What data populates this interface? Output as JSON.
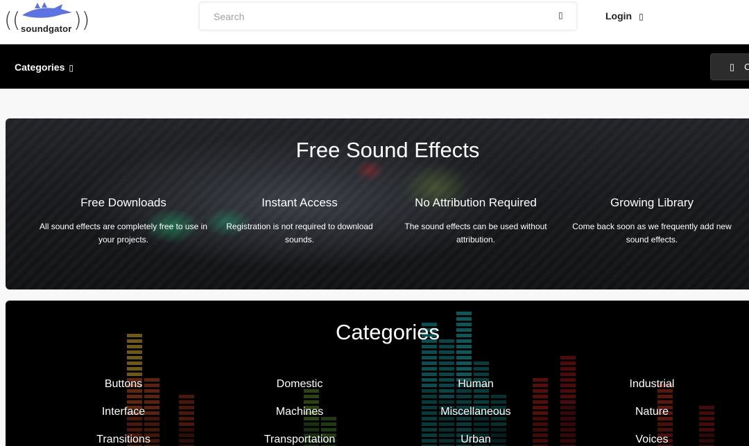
{
  "header": {
    "logo_text": "soundgator",
    "search_placeholder": "Search",
    "login_label": "Login"
  },
  "nav": {
    "categories_label": "Categories",
    "right_button_label": "C"
  },
  "hero": {
    "title": "Free Sound Effects",
    "features": [
      {
        "title": "Free Downloads",
        "desc": "All sound effects are completely free to use in your projects."
      },
      {
        "title": "Instant Access",
        "desc": "Registration is not required to download sounds."
      },
      {
        "title": "No Attribution Required",
        "desc": "The sound effects can be used without attribution."
      },
      {
        "title": "Growing Library",
        "desc": "Come back soon as we frequently add new sound effects."
      }
    ]
  },
  "categories": {
    "title": "Categories",
    "items": [
      "Buttons",
      "Domestic",
      "Human",
      "Industrial",
      "Interface",
      "Machines",
      "Miscellaneous",
      "Nature",
      "Transitions",
      "Transportation",
      "Urban",
      "Voices"
    ]
  },
  "colors": {
    "navbar_bg": "#000000",
    "accent_green": "#1eaa6e",
    "text_on_dark": "#ffffff"
  }
}
